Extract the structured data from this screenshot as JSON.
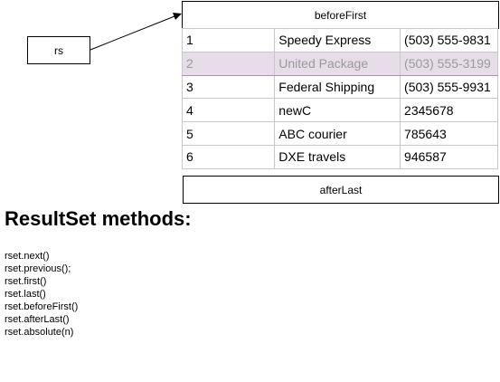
{
  "diagram": {
    "pointer_label": "rs",
    "before_first_label": "beforeFirst",
    "after_last_label": "afterLast",
    "rows": [
      {
        "id": "1",
        "name": "Speedy Express",
        "phone": "(503) 555-9831",
        "highlighted": false
      },
      {
        "id": "2",
        "name": "United Package",
        "phone": "(503) 555-3199",
        "highlighted": true
      },
      {
        "id": "3",
        "name": "Federal Shipping",
        "phone": "(503) 555-9931",
        "highlighted": false
      },
      {
        "id": "4",
        "name": "newC",
        "phone": "2345678",
        "highlighted": false
      },
      {
        "id": "5",
        "name": "ABC courier",
        "phone": "785643",
        "highlighted": false
      },
      {
        "id": "6",
        "name": "DXE travels",
        "phone": "946587",
        "highlighted": false
      }
    ]
  },
  "section": {
    "title": "ResultSet methods:",
    "methods": [
      "rset.next()",
      "rset.previous();",
      "rset.first()",
      "rset.last()",
      "rset.beforeFirst()",
      "rset.afterLast()",
      "rset.absolute(n)"
    ]
  },
  "colors": {
    "highlight_fill": "#e6dde9",
    "highlight_border": "#b08cc0",
    "grid": "#c8c8c8"
  }
}
